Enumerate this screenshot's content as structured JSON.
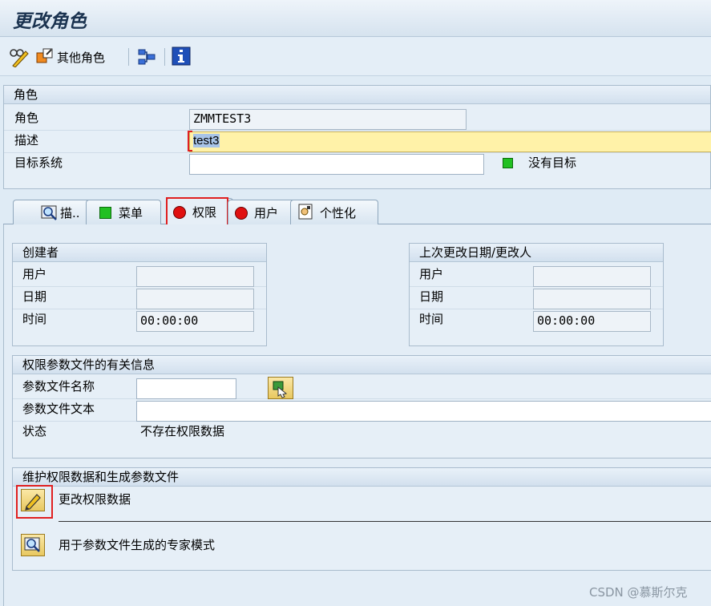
{
  "window": {
    "title": "更改角色"
  },
  "toolbar": {
    "other_roles_label": "其他角色"
  },
  "role_section": {
    "header": "角色",
    "role_label": "角色",
    "role_value": "ZMMTEST3",
    "desc_label": "描述",
    "desc_value": "test3",
    "target_label": "目标系统",
    "target_value": "",
    "status_text": "没有目标"
  },
  "tabs": [
    {
      "label": "描.."
    },
    {
      "label": "菜单"
    },
    {
      "label": "权限"
    },
    {
      "label": "用户"
    },
    {
      "label": "个性化"
    }
  ],
  "creator": {
    "header": "创建者",
    "user_label": "用户",
    "user_value": "",
    "date_label": "日期",
    "date_value": "",
    "time_label": "时间",
    "time_value": "00:00:00"
  },
  "last_change": {
    "header": "上次更改日期/更改人",
    "user_label": "用户",
    "user_value": "",
    "date_label": "日期",
    "date_value": "",
    "time_label": "时间",
    "time_value": "00:00:00"
  },
  "profile": {
    "header": "权限参数文件的有关信息",
    "name_label": "参数文件名称",
    "name_value": "",
    "text_label": "参数文件文本",
    "text_value": "",
    "status_label": "状态",
    "status_value": "不存在权限数据"
  },
  "maintain": {
    "header": "维护权限数据和生成参数文件",
    "change_label": "更改权限数据",
    "expert_label": "用于参数文件生成的专家模式"
  },
  "watermark": "CSDN @慕斯尔克",
  "colors": {
    "highlight_red": "#e02020",
    "status_green": "#22c022",
    "status_red": "#e01010",
    "desc_field_bg": "#fff2a8"
  }
}
